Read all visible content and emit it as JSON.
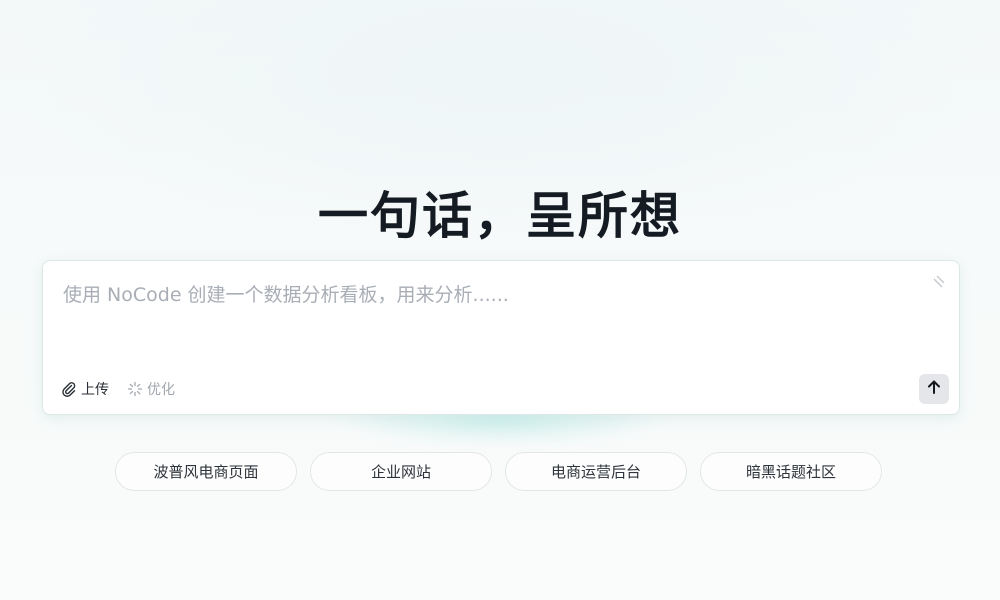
{
  "hero": {
    "title": "一句话，呈所想"
  },
  "composer": {
    "placeholder": "使用 NoCode 创建一个数据分析看板，用来分析......",
    "value": "",
    "upload_label": "上传",
    "optimize_label": "优化",
    "icons": {
      "upload": "paperclip-icon",
      "optimize": "sparkle-icon",
      "send": "arrow-up-icon",
      "resize": "resize-handle-icon"
    }
  },
  "suggestions": [
    {
      "label": "波普风电商页面"
    },
    {
      "label": "企业网站"
    },
    {
      "label": "电商运营后台"
    },
    {
      "label": "暗黑话题社区"
    }
  ],
  "colors": {
    "title": "#141b22",
    "placeholder": "#a9aeb6",
    "send_button_bg": "#e4e6ea",
    "chip_border": "#e3e6e9"
  }
}
